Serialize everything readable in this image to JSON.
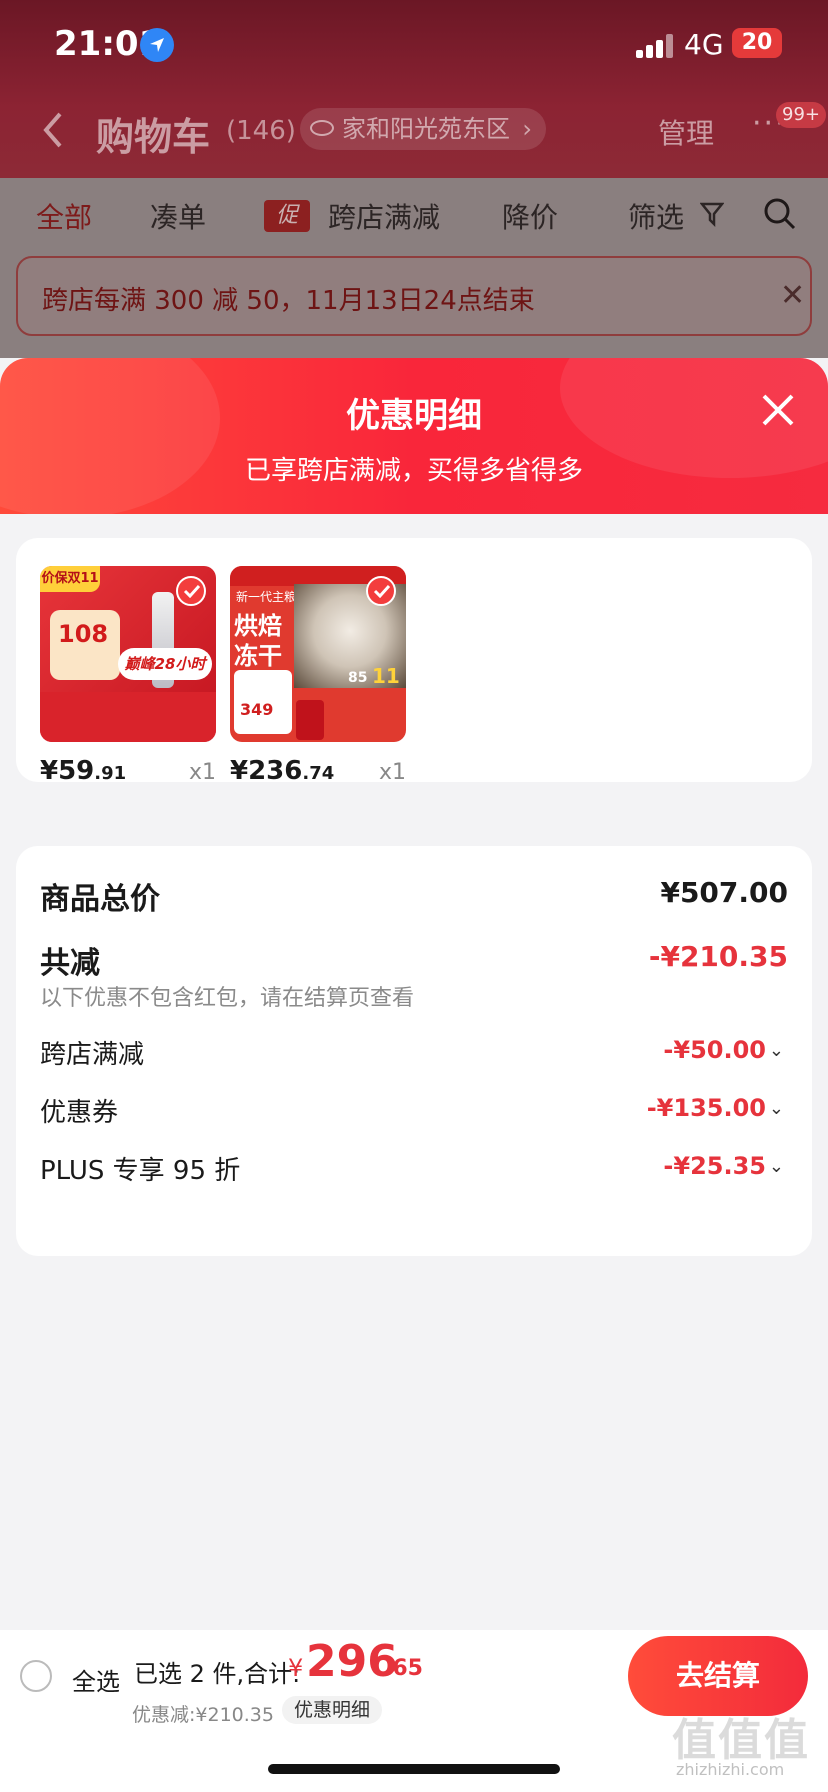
{
  "status_bar": {
    "time": "21:01",
    "network": "4G",
    "battery": "20"
  },
  "header": {
    "title": "购物车",
    "count": "(146)",
    "address": "家和阳光苑东区",
    "manage_label": "管理",
    "more_icon": "more-dots-icon",
    "more_badge": "99+"
  },
  "tabs": [
    {
      "label": "全部"
    },
    {
      "label": "凑单"
    },
    {
      "label": "跨店满减",
      "tag": "促"
    },
    {
      "label": "降价"
    },
    {
      "label": "筛选"
    }
  ],
  "promo_banner": {
    "text": "跨店每满 300 减 50，11月13日24点结束"
  },
  "sheet": {
    "title": "优惠明细",
    "subtitle": "已享跨店满减，买得多省得多",
    "products": [
      {
        "price_int": "¥59",
        "price_dec": ".91",
        "qty": "x1",
        "img_text_1": "价保双11",
        "img_text_2": "108",
        "img_text_3": "巅峰28小时"
      },
      {
        "price_int": "¥236",
        "price_dec": ".74",
        "qty": "x1",
        "img_text_1": "新一代主粮",
        "img_text_2": "烘焙",
        "img_text_3": "冻干",
        "img_text_4": "349",
        "img_text_5": "85",
        "img_text_6": "11"
      }
    ],
    "summary": {
      "goods_total_label": "商品总价",
      "goods_total_value": "¥507.00",
      "discount_label": "共减",
      "discount_value": "-¥210.35",
      "note": "以下优惠不包含红包，请在结算页查看",
      "items": [
        {
          "label": "跨店满减",
          "value": "-¥50.00"
        },
        {
          "label": "优惠券",
          "value": "-¥135.00"
        },
        {
          "label": "PLUS 专享 95 折",
          "value": "-¥25.35"
        }
      ]
    }
  },
  "bottom_bar": {
    "select_all": "全选",
    "selected_text": "已选 2 件,合计:",
    "total_symbol": "¥",
    "total_int": "296",
    "total_dec": ".65",
    "saved_text": "优惠减:¥210.35",
    "detail_label": "优惠明细",
    "checkout_label": "去结算"
  },
  "watermark": {
    "text": "值值值",
    "url": "zhizhizhi.com"
  },
  "colors": {
    "accent_red": "#e6333c",
    "sheet_header": "#f9263a",
    "checkout": "#f32b3b"
  }
}
